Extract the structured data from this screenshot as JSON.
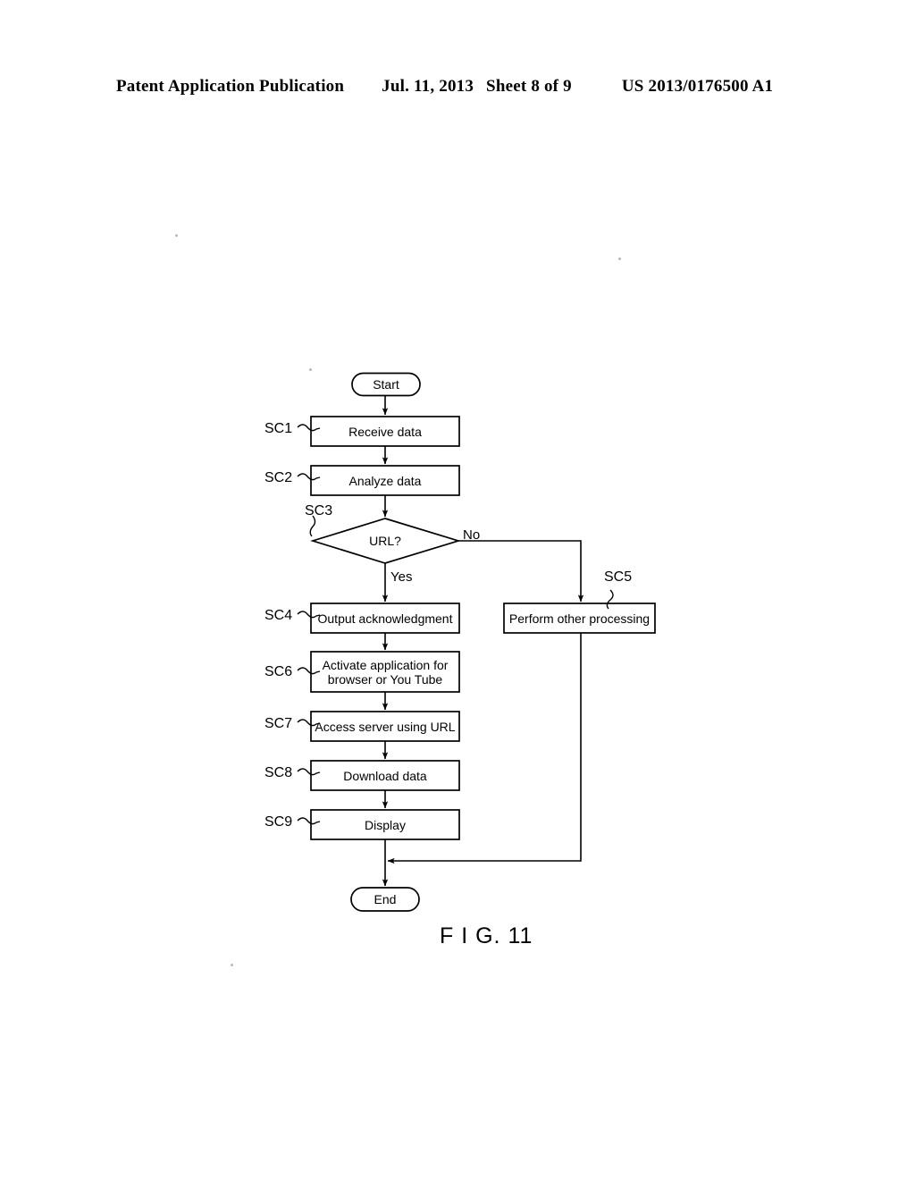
{
  "header": {
    "publication": "Patent Application Publication",
    "date": "Jul. 11, 2013",
    "sheet": "Sheet 8 of 9",
    "patent_number": "US 2013/0176500 A1"
  },
  "figure": {
    "caption": "F I G. 11",
    "nodes": {
      "start": {
        "label": "Start",
        "shape": "terminator"
      },
      "sc1": {
        "step": "SC1",
        "label": "Receive data",
        "shape": "process"
      },
      "sc2": {
        "step": "SC2",
        "label": "Analyze data",
        "shape": "process"
      },
      "sc3": {
        "step": "SC3",
        "label": "URL?",
        "shape": "decision"
      },
      "sc4": {
        "step": "SC4",
        "label": "Output acknowledgment",
        "shape": "process"
      },
      "sc5": {
        "step": "SC5",
        "label": "Perform other processing",
        "shape": "process"
      },
      "sc6": {
        "step": "SC6",
        "label": "Activate application for\nbrowser or You Tube",
        "shape": "process"
      },
      "sc7": {
        "step": "SC7",
        "label": "Access server using URL",
        "shape": "process"
      },
      "sc8": {
        "step": "SC8",
        "label": "Download data",
        "shape": "process"
      },
      "sc9": {
        "step": "SC9",
        "label": "Display",
        "shape": "process"
      },
      "end": {
        "label": "End",
        "shape": "terminator"
      }
    },
    "edge_labels": {
      "yes": "Yes",
      "no": "No"
    }
  },
  "colors": {
    "ink": "#000000",
    "paper": "#ffffff"
  }
}
